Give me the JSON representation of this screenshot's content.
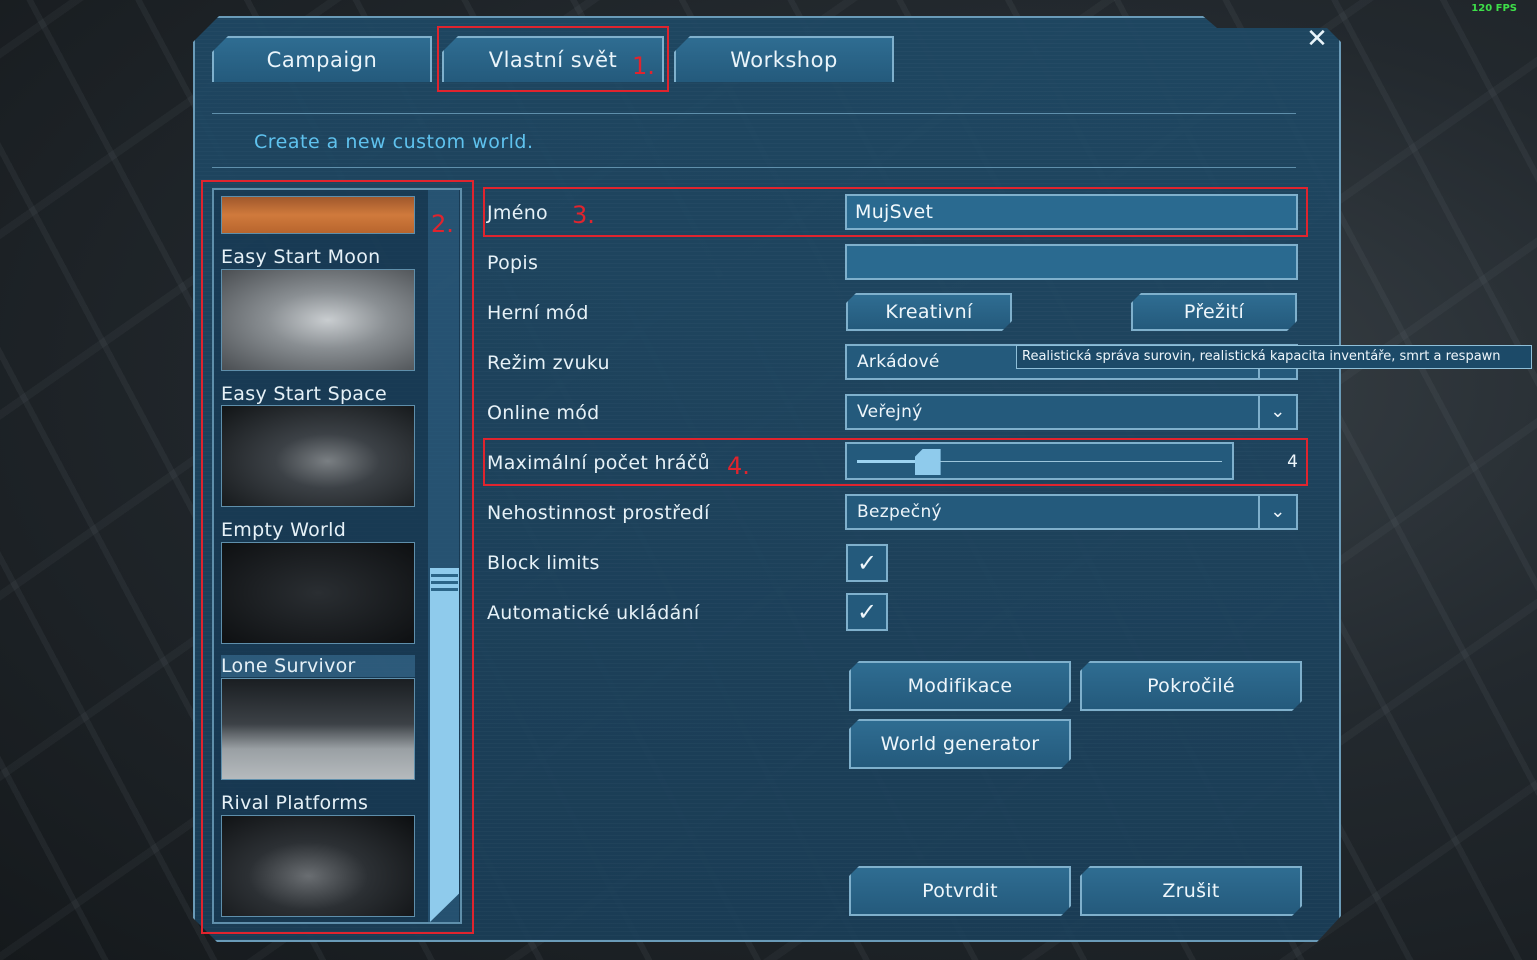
{
  "fps": "120 FPS",
  "tabs": [
    {
      "label": "Campaign"
    },
    {
      "label": "Vlastní svět"
    },
    {
      "label": "Workshop"
    }
  ],
  "subtitle": "Create a new custom world.",
  "worlds": [
    {
      "label": "Easy Start Moon"
    },
    {
      "label": "Easy Start Space"
    },
    {
      "label": "Empty World"
    },
    {
      "label": "Lone Survivor"
    },
    {
      "label": "Rival Platforms"
    }
  ],
  "form": {
    "name_label": "Jméno",
    "name_value": "MujSvet",
    "description_label": "Popis",
    "description_value": "",
    "game_mode_label": "Herní mód",
    "game_mode_creative": "Kreativní",
    "game_mode_survival": "Přežití",
    "sound_label": "Režim zvuku",
    "sound_value": "Arkádové",
    "tooltip": "Realistická správa surovin, realistická kapacita inventáře, smrt a respawn",
    "online_label": "Online mód",
    "online_value": "Veřejný",
    "max_players_label": "Maximální počet hráčů",
    "max_players_value": "4",
    "max_players_fraction": 0.17,
    "environment_label": "Nehostinnost prostředí",
    "environment_value": "Bezpečný",
    "block_limits_label": "Block limits",
    "autosave_label": "Automatické ukládání",
    "check_mark": "✓",
    "combo_arrow": "⌄"
  },
  "buttons": {
    "mods": "Modifikace",
    "advanced": "Pokročilé",
    "world_generator": "World generator",
    "confirm": "Potvrdit",
    "cancel": "Zrušit"
  },
  "annotations": [
    "1.",
    "2.",
    "3.",
    "4."
  ],
  "colors": {
    "accent": "#5fc2ee",
    "annotation": "#e0242e",
    "panel": "#1e4864"
  },
  "icons": {
    "close": "close-icon"
  }
}
